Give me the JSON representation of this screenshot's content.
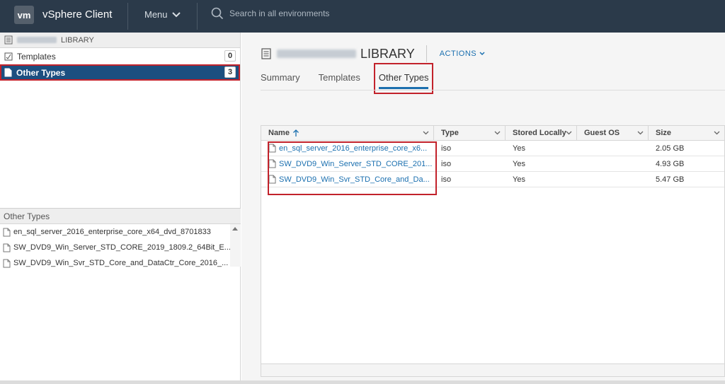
{
  "header": {
    "logo": "vm",
    "app_title": "vSphere Client",
    "menu_label": "Menu",
    "search_placeholder": "Search in all environments",
    "background": "#2b3a4a"
  },
  "sidebar": {
    "library_label": "LIBRARY",
    "items": [
      {
        "label": "Templates",
        "count": "0",
        "icon": "template-icon"
      },
      {
        "label": "Other Types",
        "count": "3",
        "icon": "file-icon",
        "selected": true
      }
    ],
    "selected_color": "#1c4f80"
  },
  "other_types_panel": {
    "title": "Other Types",
    "items": [
      "en_sql_server_2016_enterprise_core_x64_dvd_8701833",
      "SW_DVD9_Win_Server_STD_CORE_2019_1809.2_64Bit_E...",
      "SW_DVD9_Win_Svr_STD_Core_and_DataCtr_Core_2016_..."
    ]
  },
  "main": {
    "title": "LIBRARY",
    "actions_label": "ACTIONS",
    "tabs": [
      {
        "label": "Summary"
      },
      {
        "label": "Templates"
      },
      {
        "label": "Other Types",
        "active": true
      }
    ],
    "grid": {
      "columns": [
        {
          "label": "Name",
          "sorted": "ascending"
        },
        {
          "label": "Type"
        },
        {
          "label": "Stored Locally"
        },
        {
          "label": "Guest OS"
        },
        {
          "label": "Size"
        }
      ],
      "rows": [
        {
          "name": "en_sql_server_2016_enterprise_core_x6...",
          "type": "iso",
          "stored_locally": "Yes",
          "guest_os": "",
          "size": "2.05 GB"
        },
        {
          "name": "SW_DVD9_Win_Server_STD_CORE_201...",
          "type": "iso",
          "stored_locally": "Yes",
          "guest_os": "",
          "size": "4.93 GB"
        },
        {
          "name": "SW_DVD9_Win_Svr_STD_Core_and_Da...",
          "type": "iso",
          "stored_locally": "Yes",
          "guest_os": "",
          "size": "5.47 GB"
        }
      ]
    },
    "accent": "#1a6faf",
    "highlight": "#c2222b"
  }
}
